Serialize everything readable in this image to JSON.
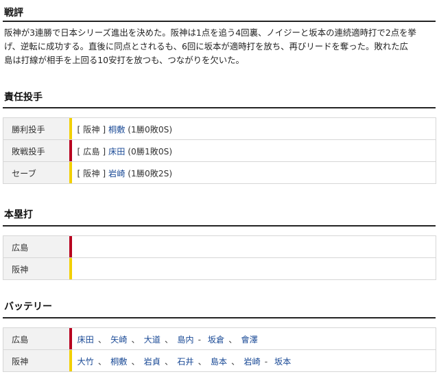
{
  "summary": {
    "title": "戦評",
    "lines": [
      "阪神が3連勝で日本シリーズ進出を決めた。阪神は1点を追う4回裏、ノイジーと坂本の連続適時打で2点を挙",
      "げ、逆転に成功する。直後に同点とされるも、6回に坂本が適時打を放ち、再びリードを奪った。敗れた広",
      "島は打線が相手を上回る10安打を放つも、つながりを欠いた。"
    ]
  },
  "pitchers": {
    "title": "責任投手",
    "rows": [
      {
        "label": "勝利投手",
        "team": "阪神",
        "name": "桐敷",
        "record": "(1勝0敗0S)"
      },
      {
        "label": "敗戦投手",
        "team": "広島",
        "name": "床田",
        "record": "(0勝1敗0S)"
      },
      {
        "label": "セーブ",
        "team": "阪神",
        "name": "岩崎",
        "record": "(1勝0敗2S)"
      }
    ]
  },
  "homeruns": {
    "title": "本塁打",
    "rows": [
      {
        "label": "広島",
        "value": ""
      },
      {
        "label": "阪神",
        "value": ""
      }
    ]
  },
  "battery": {
    "title": "バッテリー",
    "rows": [
      {
        "label": "広島",
        "pitchers": [
          "床田",
          "矢崎",
          "大道",
          "島内"
        ],
        "catchers": [
          "坂倉",
          "會澤"
        ]
      },
      {
        "label": "阪神",
        "pitchers": [
          "大竹",
          "桐敷",
          "岩貞",
          "石井",
          "島本",
          "岩崎"
        ],
        "catchers": [
          "坂本"
        ]
      }
    ]
  },
  "colors": {
    "hanshin": "#f2d000",
    "hiroshima": "#b8001f",
    "link": "#1a4a96"
  }
}
